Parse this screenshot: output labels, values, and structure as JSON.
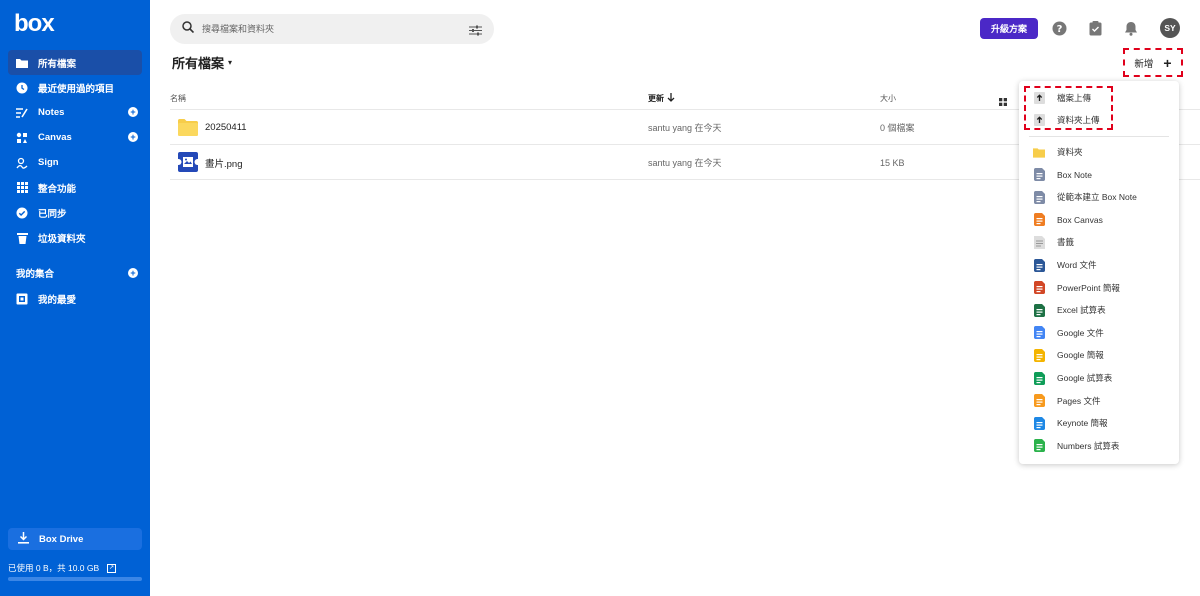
{
  "app": {
    "logo": "box"
  },
  "sidebar": {
    "items": [
      {
        "label": "所有檔案",
        "icon": "folder-icon",
        "active": true
      },
      {
        "label": "最近使用過的項目",
        "icon": "clock-icon"
      },
      {
        "label": "Notes",
        "icon": "notes-icon",
        "plus": true
      },
      {
        "label": "Canvas",
        "icon": "canvas-icon",
        "plus": true
      },
      {
        "label": "Sign",
        "icon": "sign-icon"
      },
      {
        "label": "整合功能",
        "icon": "apps-grid-icon"
      },
      {
        "label": "已同步",
        "icon": "check-circle-icon"
      },
      {
        "label": "垃圾資料夾",
        "icon": "trash-icon"
      }
    ],
    "collections_title": "我的集合",
    "favorites_label": "我的最愛",
    "box_drive_label": "Box Drive",
    "storage_text": "已使用 0 B，共 10.0 GB",
    "storage_used_fraction": 0.0
  },
  "header": {
    "search_placeholder": "搜尋檔案和資料夾",
    "upgrade_label": "升級方案",
    "avatar_initials": "SY"
  },
  "main": {
    "title": "所有檔案",
    "new_label": "新增",
    "columns": {
      "name": "名稱",
      "updated": "更新",
      "size": "大小"
    },
    "rows": [
      {
        "name": "20250411",
        "type": "folder",
        "updated": "santu yang 在今天",
        "size": "0 個檔案"
      },
      {
        "name": "畫片.png",
        "type": "image",
        "updated": "santu yang 在今天",
        "size": "15 KB"
      }
    ]
  },
  "menu": {
    "upload_items": [
      {
        "label": "檔案上傳",
        "icon": "upload-icon"
      },
      {
        "label": "資料夾上傳",
        "icon": "upload-icon"
      }
    ],
    "create_items": [
      {
        "label": "資料夾",
        "icon": "folder-icon",
        "color": "#f7cd4a"
      },
      {
        "label": "Box Note",
        "icon": "box-note-icon",
        "color": "#7e8ba6"
      },
      {
        "label": "從範本建立 Box Note",
        "icon": "box-note-icon",
        "color": "#7e8ba6"
      },
      {
        "label": "Box Canvas",
        "icon": "box-canvas-icon",
        "color": "#ef7d22"
      },
      {
        "label": "書籤",
        "icon": "bookmark-icon",
        "color": "#999999"
      },
      {
        "label": "Word 文件",
        "icon": "word-icon",
        "color": "#2b5797"
      },
      {
        "label": "PowerPoint 簡報",
        "icon": "powerpoint-icon",
        "color": "#d24726"
      },
      {
        "label": "Excel 試算表",
        "icon": "excel-icon",
        "color": "#1e7145"
      },
      {
        "label": "Google 文件",
        "icon": "google-docs-icon",
        "color": "#4285f4"
      },
      {
        "label": "Google 簡報",
        "icon": "google-slides-icon",
        "color": "#f4b400"
      },
      {
        "label": "Google 試算表",
        "icon": "google-sheets-icon",
        "color": "#0f9d58"
      },
      {
        "label": "Pages 文件",
        "icon": "pages-icon",
        "color": "#f79a1e"
      },
      {
        "label": "Keynote 簡報",
        "icon": "keynote-icon",
        "color": "#1e88e5"
      },
      {
        "label": "Numbers 試算表",
        "icon": "numbers-icon",
        "color": "#2bb24c"
      }
    ]
  }
}
